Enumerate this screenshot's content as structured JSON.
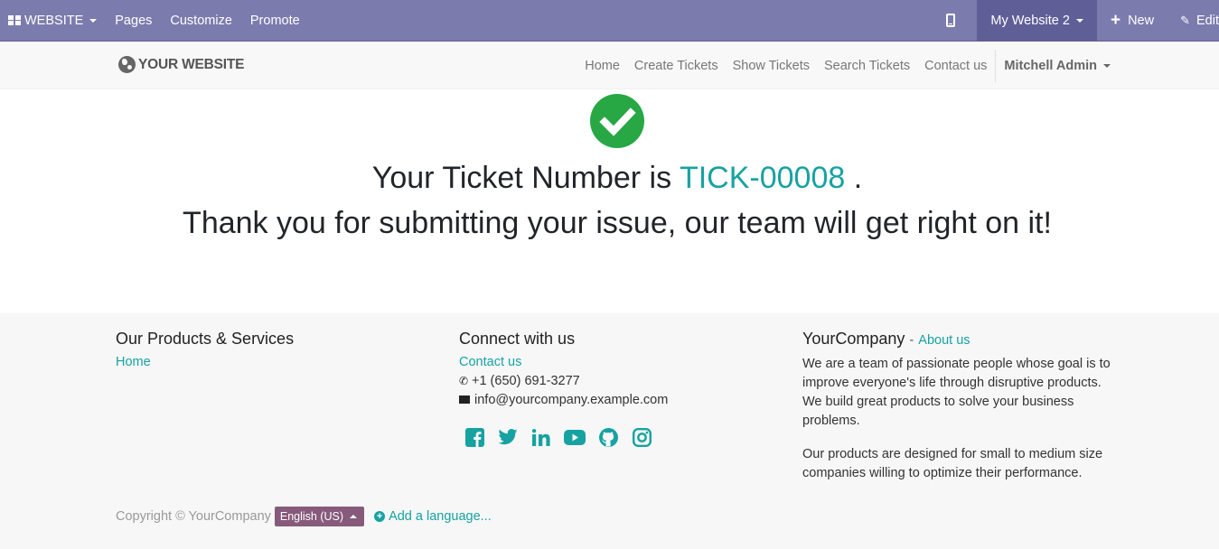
{
  "adminbar": {
    "apps_label": "WEBSITE",
    "menu": [
      "Pages",
      "Customize",
      "Promote"
    ],
    "website_switch": "My Website 2",
    "new_label": "New",
    "edit_label": "Edit"
  },
  "header": {
    "logo_text": "YOUR WEBSITE",
    "nav": [
      "Home",
      "Create Tickets",
      "Show Tickets",
      "Search Tickets",
      "Contact us"
    ],
    "user": "Mitchell Admin"
  },
  "main": {
    "ticket_prefix": "Your Ticket Number is",
    "ticket_number": "TICK-00008",
    "ticket_suffix": ".",
    "thanks": "Thank you for submitting your issue, our team will get right on it!"
  },
  "footer": {
    "col1": {
      "title": "Our Products & Services",
      "links": [
        "Home"
      ]
    },
    "col2": {
      "title": "Connect with us",
      "contact_link": "Contact us",
      "phone": "+1 (650) 691-3277",
      "email": "info@yourcompany.example.com",
      "socials": [
        "facebook-icon",
        "twitter-icon",
        "linkedin-icon",
        "youtube-icon",
        "github-icon",
        "instagram-icon"
      ]
    },
    "col3": {
      "title": "YourCompany",
      "dash": "-",
      "about_link": "About us",
      "para1": "We are a team of passionate people whose goal is to improve everyone's life through disruptive products. We build great products to solve your business problems.",
      "para2": "Our products are designed for small to medium size companies willing to optimize their performance."
    },
    "copyright": "Copyright © YourCompany",
    "language": "English (US)",
    "add_language": "Add a language..."
  },
  "colors": {
    "admin_bar": "#7c7bad",
    "accent": "#17a2a2",
    "success": "#28a745",
    "lang_button": "#875a7b"
  }
}
